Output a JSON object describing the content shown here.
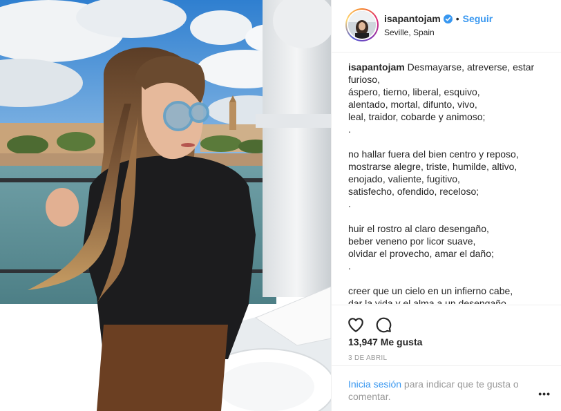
{
  "header": {
    "username": "isapantojam",
    "follow_label": "Seguir",
    "separator": "•",
    "location": "Seville, Spain"
  },
  "caption": {
    "username": "isapantojam",
    "text": " Desmayarse, atreverse, estar furioso,\náspero, tierno, liberal, esquivo,\nalentado, mortal, difunto, vivo,\nleal, traidor, cobarde y animoso;\n.\n\nno hallar fuera del bien centro y reposo,\nmostrarse alegre, triste, humilde, altivo,\nenojado, valiente, fugitivo,\nsatisfecho, ofendido, receloso;\n.\n\nhuir el rostro al claro desengaño,\nbeber veneno por licor suave,\nolvidar el provecho, amar el daño;\n.\n\ncreer que un cielo en un infierno cabe,\ndar la vida y el alma a un desengaño"
  },
  "actions": {
    "like_icon": "heart-icon",
    "comment_icon": "comment-icon"
  },
  "likes": "13,947 Me gusta",
  "date": "3 DE ABRIL",
  "login": {
    "link_label": "Inicia sesión",
    "rest": " para indicar que te gusta o comentar."
  },
  "more_label": "•••",
  "colors": {
    "link_blue": "#3897f0",
    "text": "#262626",
    "muted": "#999999",
    "border": "#efefef"
  }
}
